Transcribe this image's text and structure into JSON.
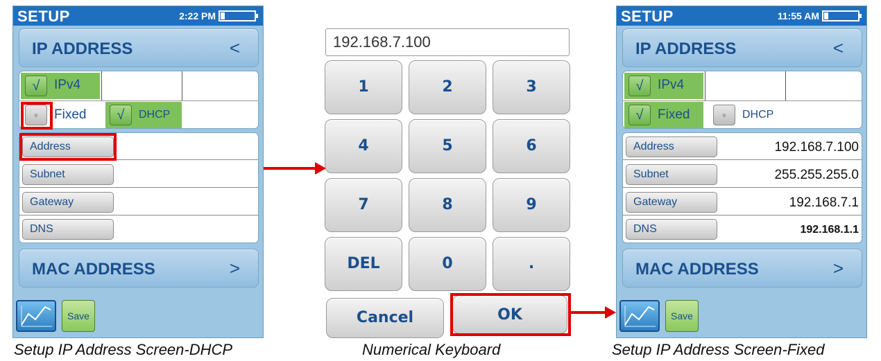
{
  "left_screen": {
    "title": "SETUP",
    "time": "2:22 PM",
    "ip_header": "IP ADDRESS",
    "ip_arrow": "<",
    "ipv4_label": "IPv4",
    "fixed_label": "Fixed",
    "dhcp_label": "DHCP",
    "check_mark": "√",
    "fields": [
      {
        "label": "Address",
        "value": ""
      },
      {
        "label": "Subnet",
        "value": ""
      },
      {
        "label": "Gateway",
        "value": ""
      },
      {
        "label": "DNS",
        "value": ""
      }
    ],
    "mac_header": "MAC ADDRESS",
    "mac_arrow": ">",
    "save_label": "Save",
    "caption": "Setup IP Address Screen-DHCP"
  },
  "keypad": {
    "input_value": "192.168.7.100",
    "keys": [
      "1",
      "2",
      "3",
      "4",
      "5",
      "6",
      "7",
      "8",
      "9",
      "DEL",
      "0",
      "."
    ],
    "cancel_label": "Cancel",
    "ok_label": "OK",
    "caption": "Numerical Keyboard"
  },
  "right_screen": {
    "title": "SETUP",
    "time": "11:55 AM",
    "ip_header": "IP ADDRESS",
    "ip_arrow": "<",
    "ipv4_label": "IPv4",
    "fixed_label": "Fixed",
    "dhcp_label": "DHCP",
    "check_mark": "√",
    "fields": [
      {
        "label": "Address",
        "value": "192.168.7.100"
      },
      {
        "label": "Subnet",
        "value": "255.255.255.0"
      },
      {
        "label": "Gateway",
        "value": "192.168.7.1"
      },
      {
        "label": "DNS",
        "value": "192.168.1.1"
      }
    ],
    "mac_header": "MAC ADDRESS",
    "mac_arrow": ">",
    "save_label": "Save",
    "caption": "Setup IP Address Screen-Fixed"
  },
  "colors": {
    "highlight_red": "#e00000",
    "screen_bg": "#9cc6e2",
    "title_bar": "#1f6fc0",
    "check_green": "#7ec15b",
    "label_blue": "#1b4f8c"
  }
}
